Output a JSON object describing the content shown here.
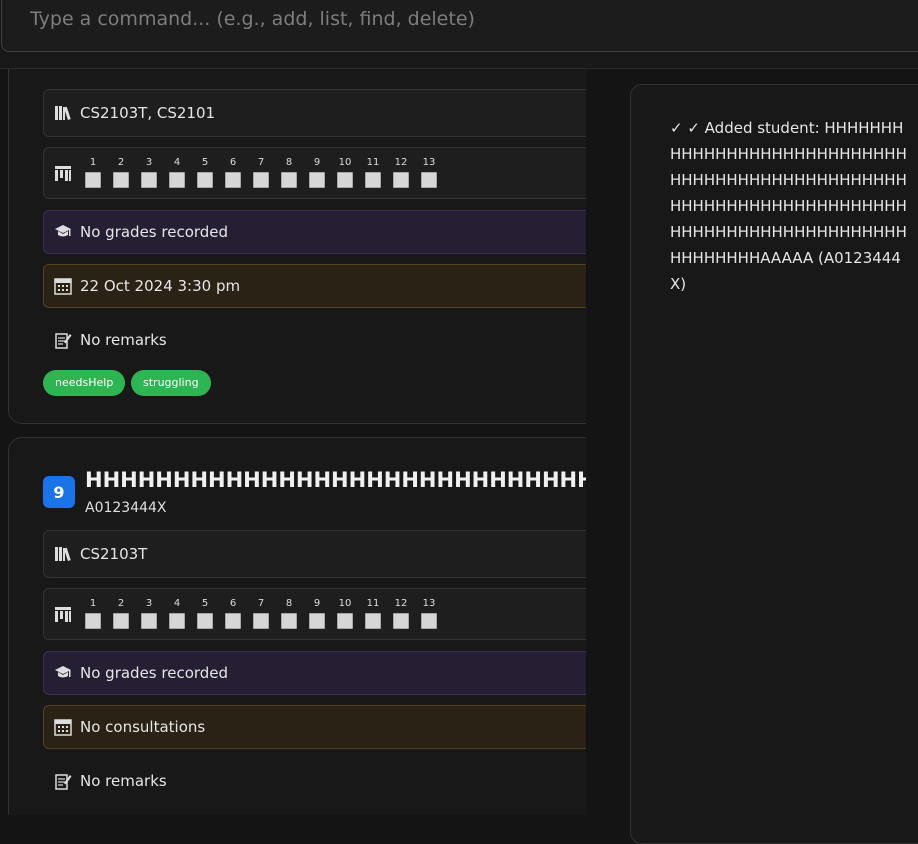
{
  "command_box": {
    "placeholder": "Type a command... (e.g., add, list, find, delete)"
  },
  "student_cards": [
    {
      "courses": "CS2103T, CS2101",
      "weeks": [
        "1",
        "2",
        "3",
        "4",
        "5",
        "6",
        "7",
        "8",
        "9",
        "10",
        "11",
        "12",
        "13"
      ],
      "grades": "No grades recorded",
      "consultation": "22 Oct 2024 3:30 pm",
      "remarks": "No remarks",
      "tags": [
        "needsHelp",
        "struggling"
      ]
    },
    {
      "index": "9",
      "name": "HHHHHHHHHHHHHHHHHHHHHHHHHHHHHHHHHHHHHHHHHHHHHHHHHHHHHHHHHHHHHHHHHHHHHHHHHHHHHHHHHHHHHHHHHHHHHHHHHHHAAAAA",
      "student_id": "A0123444X",
      "courses": "CS2103T",
      "weeks": [
        "1",
        "2",
        "3",
        "4",
        "5",
        "6",
        "7",
        "8",
        "9",
        "10",
        "11",
        "12",
        "13"
      ],
      "grades": "No grades recorded",
      "consultation": "No consultations",
      "remarks": "No remarks"
    }
  ],
  "result_panel": {
    "message": "✓ ✓ Added student: HHHHHHHHHHHHHHHHHHHHHHHHHHHHHHHHHHHHHHHHHHHHHHHHHHHHHHHHHHHHHHHHHHHHHHHHHHHHHHHHHHHHHHHHHHHHHHHHHHHAAAAA (A0123444X)"
  },
  "icons": {
    "courses": "books-icon",
    "attendance": "attendance-grid-icon",
    "grades": "graduation-cap-icon",
    "consultation": "calendar-icon",
    "remarks": "memo-icon"
  },
  "colors": {
    "tag_green": "#2db551",
    "index_blue": "#1a73e8"
  }
}
